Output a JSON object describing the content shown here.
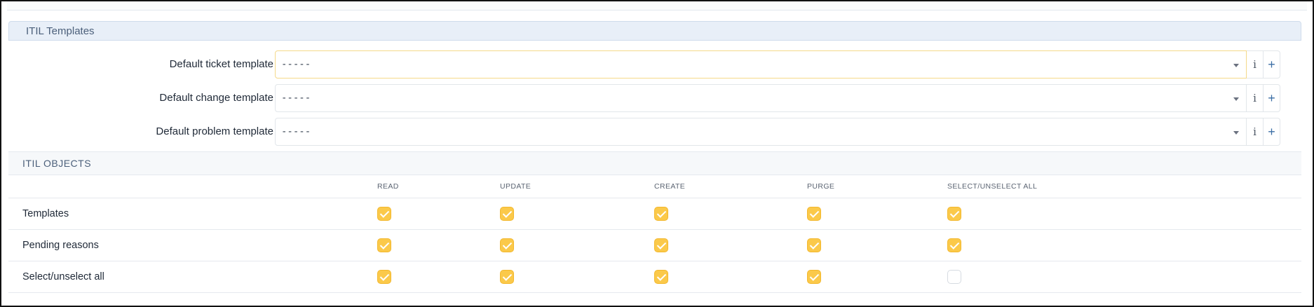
{
  "section": {
    "title": "ITIL Templates"
  },
  "templates": [
    {
      "label": "Default ticket template",
      "value": "-----",
      "focused": true
    },
    {
      "label": "Default change template",
      "value": "-----",
      "focused": false
    },
    {
      "label": "Default problem template",
      "value": "-----",
      "focused": false
    }
  ],
  "addons": {
    "info": "i",
    "add": "+"
  },
  "objects": {
    "title": "ITIL OBJECTS",
    "columns": [
      "READ",
      "UPDATE",
      "CREATE",
      "PURGE",
      "SELECT/UNSELECT ALL"
    ],
    "rows": [
      {
        "label": "Templates",
        "checks": [
          true,
          true,
          true,
          true,
          true
        ]
      },
      {
        "label": "Pending reasons",
        "checks": [
          true,
          true,
          true,
          true,
          true
        ]
      },
      {
        "label": "Select/unselect all",
        "checks": [
          true,
          true,
          true,
          true,
          false
        ]
      }
    ]
  },
  "colors": {
    "accent": "#fbc94a",
    "header_bg": "#e8eff8"
  },
  "icons": {
    "dropdown": "chevron-down-icon",
    "info": "info-icon",
    "add": "plus-icon",
    "check": "check-icon"
  }
}
